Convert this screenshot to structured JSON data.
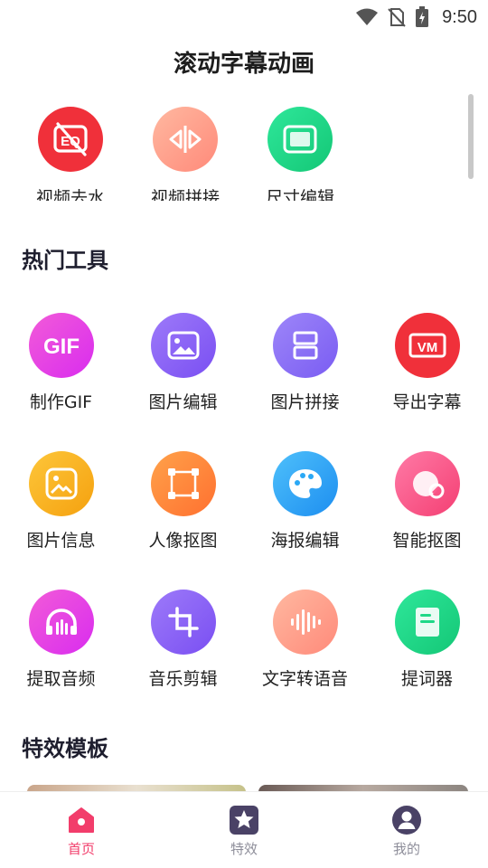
{
  "status_bar": {
    "time": "9:50",
    "icons": [
      "wifi-icon",
      "no-sim-icon",
      "battery-charging-icon"
    ]
  },
  "page": {
    "title": "滚动字幕动画"
  },
  "top_tools": [
    {
      "label": "视频去水",
      "icon": "remove-watermark-icon",
      "color": "#f0303a"
    },
    {
      "label": "视频拼接",
      "icon": "video-splice-icon",
      "color": "#ff9e84"
    },
    {
      "label": "尺寸编辑",
      "icon": "resize-icon",
      "color": "#1ed887"
    }
  ],
  "hot_tools": {
    "title": "热门工具",
    "items": [
      {
        "label": "制作GIF",
        "icon": "gif-icon",
        "color": "#ee3fd6"
      },
      {
        "label": "图片编辑",
        "icon": "image-edit-icon",
        "color": "#8d63f6"
      },
      {
        "label": "图片拼接",
        "icon": "image-splice-icon",
        "color": "#8a6ff5"
      },
      {
        "label": "导出字幕",
        "icon": "export-subtitle-icon",
        "color": "#f0303a"
      },
      {
        "label": "图片信息",
        "icon": "image-info-icon",
        "color": "#f8b21e"
      },
      {
        "label": "人像抠图",
        "icon": "portrait-cutout-icon",
        "color": "#ff8a3d"
      },
      {
        "label": "海报编辑",
        "icon": "poster-edit-icon",
        "color": "#2aa8f5"
      },
      {
        "label": "智能抠图",
        "icon": "smart-cutout-icon",
        "color": "#fc5b8c"
      },
      {
        "label": "提取音频",
        "icon": "extract-audio-icon",
        "color": "#ee3fd6"
      },
      {
        "label": "音乐剪辑",
        "icon": "music-crop-icon",
        "color": "#8d63f6"
      },
      {
        "label": "文字转语音",
        "icon": "text-to-speech-icon",
        "color": "#ff9e84"
      },
      {
        "label": "提词器",
        "icon": "teleprompter-icon",
        "color": "#1ed887"
      }
    ]
  },
  "templates": {
    "title": "特效模板"
  },
  "tab_bar": {
    "items": [
      {
        "label": "首页",
        "icon": "home-icon",
        "active": true
      },
      {
        "label": "特效",
        "icon": "effects-star-icon",
        "active": false
      },
      {
        "label": "我的",
        "icon": "profile-icon",
        "active": false
      }
    ],
    "active_color": "#f23d6b",
    "inactive_color": "#8e8e9a"
  }
}
